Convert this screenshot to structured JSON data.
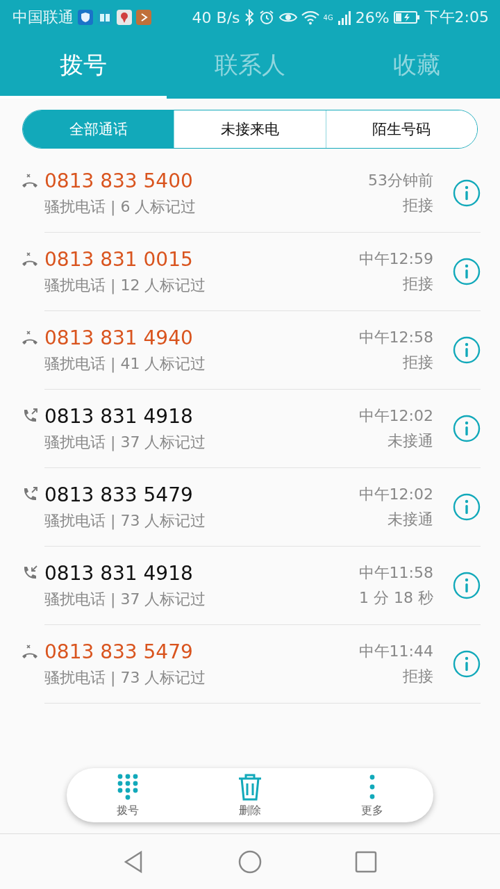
{
  "status_bar": {
    "carrier": "中国联通",
    "speed": "40 B/s",
    "network": "4G",
    "battery": "26%",
    "time": "下午2:05"
  },
  "tabs": [
    {
      "label": "拨号",
      "selected": true
    },
    {
      "label": "联系人",
      "selected": false
    },
    {
      "label": "收藏",
      "selected": false
    }
  ],
  "filters": [
    {
      "label": "全部通话",
      "selected": true
    },
    {
      "label": "未接来电",
      "selected": false
    },
    {
      "label": "陌生号码",
      "selected": false
    }
  ],
  "calls": [
    {
      "kind": "rejected",
      "number": "0813 833 5400",
      "tag": "骚扰电话 | 6 人标记过",
      "time": "53分钟前",
      "status": "拒接"
    },
    {
      "kind": "rejected",
      "number": "0813 831 0015",
      "tag": "骚扰电话 | 12 人标记过",
      "time": "中午12:59",
      "status": "拒接"
    },
    {
      "kind": "rejected",
      "number": "0813 831 4940",
      "tag": "骚扰电话 | 41 人标记过",
      "time": "中午12:58",
      "status": "拒接"
    },
    {
      "kind": "outgoing",
      "number": "0813 831 4918",
      "tag": "骚扰电话 | 37 人标记过",
      "time": "中午12:02",
      "status": "未接通"
    },
    {
      "kind": "outgoing",
      "number": "0813 833 5479",
      "tag": "骚扰电话 | 73 人标记过",
      "time": "中午12:02",
      "status": "未接通"
    },
    {
      "kind": "incoming",
      "number": "0813 831 4918",
      "tag": "骚扰电话 | 37 人标记过",
      "time": "中午11:58",
      "status": "1 分 18 秒"
    },
    {
      "kind": "rejected",
      "number": "0813 833 5479",
      "tag": "骚扰电话 | 73 人标记过",
      "time": "中午11:44",
      "status": "拒接"
    }
  ],
  "actions": [
    {
      "kind": "dialpad",
      "label": "拨号"
    },
    {
      "kind": "delete",
      "label": "删除"
    },
    {
      "kind": "more",
      "label": "更多"
    }
  ]
}
